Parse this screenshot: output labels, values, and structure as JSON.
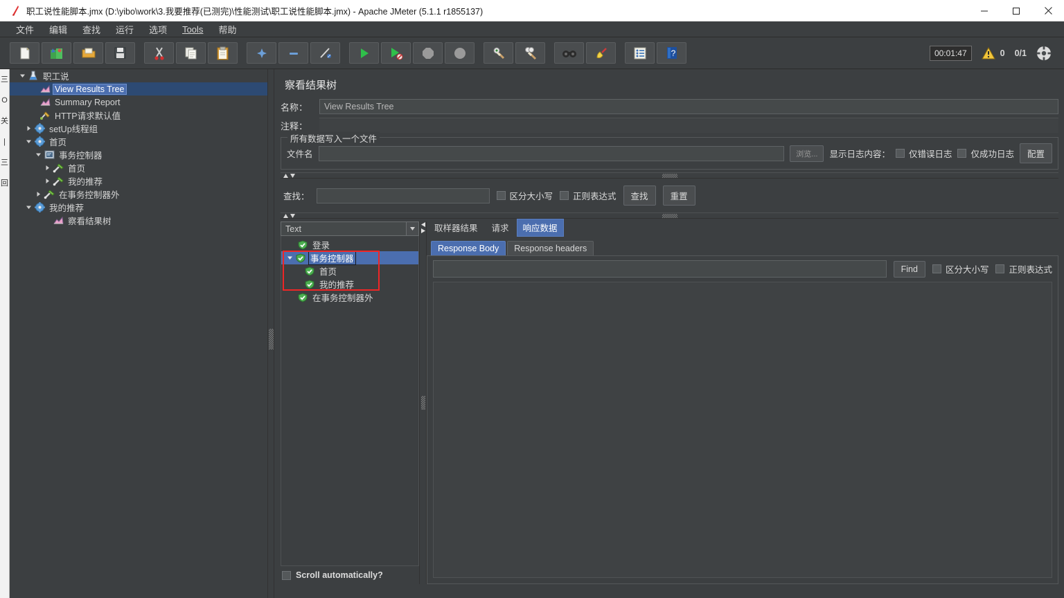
{
  "window": {
    "title": "职工说性能脚本.jmx (D:\\yibo\\work\\3.我要推荐(已测完)\\性能测试\\职工说性能脚本.jmx) - Apache JMeter (5.1.1 r1855137)",
    "app_icon": "jmeter-feather-icon",
    "minimize_label": "—",
    "maximize_label": "☐",
    "close_label": "✕"
  },
  "menubar": {
    "items": [
      {
        "label": "文件",
        "name": "menu-file"
      },
      {
        "label": "编辑",
        "name": "menu-edit"
      },
      {
        "label": "查找",
        "name": "menu-search"
      },
      {
        "label": "运行",
        "name": "menu-run"
      },
      {
        "label": "选项",
        "name": "menu-options"
      },
      {
        "label": "Tools",
        "name": "menu-tools"
      },
      {
        "label": "帮助",
        "name": "menu-help"
      }
    ]
  },
  "toolbar": {
    "buttons": [
      {
        "name": "new-icon",
        "glyph": "📄",
        "tip": "新建"
      },
      {
        "name": "templates-icon",
        "glyph": "🗂",
        "tip": "模板"
      },
      {
        "name": "open-icon",
        "glyph": "📂",
        "tip": "打开"
      },
      {
        "name": "save-icon",
        "glyph": "💾",
        "tip": "保存"
      },
      {
        "name": "cut-icon",
        "glyph": "✂",
        "tip": "剪切"
      },
      {
        "name": "copy-icon",
        "glyph": "📑",
        "tip": "复制"
      },
      {
        "name": "paste-icon",
        "glyph": "📋",
        "tip": "粘贴"
      },
      {
        "name": "expand-all-icon",
        "glyph": "+",
        "tip": "展开全部"
      },
      {
        "name": "collapse-all-icon",
        "glyph": "−",
        "tip": "折叠全部"
      },
      {
        "name": "toggle-icon",
        "glyph": "🖉",
        "tip": "开关"
      },
      {
        "name": "start-icon",
        "glyph": "▶",
        "tip": "启动"
      },
      {
        "name": "start-no-pause-icon",
        "glyph": "▶",
        "tip": "无间隔启动"
      },
      {
        "name": "stop-icon",
        "glyph": "⬤",
        "tip": "停止"
      },
      {
        "name": "shutdown-icon",
        "glyph": "⬤",
        "tip": "关闭"
      },
      {
        "name": "clear-icon",
        "glyph": "🧹",
        "tip": "清除"
      },
      {
        "name": "clear-all-icon",
        "glyph": "🧹",
        "tip": "清除全部"
      },
      {
        "name": "search-icon",
        "glyph": "🔍",
        "tip": "查找"
      },
      {
        "name": "search-reset-icon",
        "glyph": "🔔",
        "tip": "重置查找"
      },
      {
        "name": "function-helper-icon",
        "glyph": "☰",
        "tip": "函数助手"
      },
      {
        "name": "help-icon",
        "glyph": "?",
        "tip": "帮助"
      }
    ],
    "timer": "00:01:47",
    "warning_count": "0",
    "thread_count": "0/1",
    "warning_icon": "warning-triangle-icon",
    "threads-icon": "threads-gear-icon"
  },
  "tree": {
    "nodes": [
      {
        "label": "职工说",
        "depth": 0,
        "toggle": "open",
        "icon": "test-plan-icon",
        "selected": false
      },
      {
        "label": "View Results Tree",
        "depth": 1,
        "toggle": "none",
        "icon": "listener-icon",
        "selected": true
      },
      {
        "label": "Summary Report",
        "depth": 1,
        "toggle": "none",
        "icon": "listener-icon",
        "selected": false
      },
      {
        "label": "HTTP请求默认值",
        "depth": 1,
        "toggle": "none",
        "icon": "config-icon",
        "selected": false
      },
      {
        "label": "setUp线程组",
        "depth": 1,
        "toggle": "closed",
        "icon": "thread-group-icon",
        "selected": false
      },
      {
        "label": "首页",
        "depth": 1,
        "toggle": "open",
        "icon": "thread-group-icon",
        "selected": false
      },
      {
        "label": "事务控制器",
        "depth": 2,
        "toggle": "open",
        "icon": "controller-icon",
        "selected": false
      },
      {
        "label": "首页",
        "depth": 3,
        "toggle": "closed",
        "icon": "http-sampler-icon",
        "selected": false
      },
      {
        "label": "我的推荐",
        "depth": 3,
        "toggle": "closed",
        "icon": "http-sampler-icon",
        "selected": false
      },
      {
        "label": "在事务控制器外",
        "depth": 2,
        "toggle": "closed",
        "icon": "http-sampler-icon",
        "selected": false
      },
      {
        "label": "我的推荐",
        "depth": 1,
        "toggle": "open",
        "icon": "thread-group-icon",
        "selected": false
      },
      {
        "label": "察看结果树",
        "depth": 2,
        "toggle": "none",
        "icon": "listener-icon",
        "selected": false
      }
    ]
  },
  "editor": {
    "title": "察看结果树",
    "name_label": "名称：",
    "name_value": "View Results Tree",
    "comment_label": "注释：",
    "comment_value": "",
    "filegroup": {
      "title": "所有数据写入一个文件",
      "filename_label": "文件名",
      "filename_value": "",
      "browse_label": "浏览...",
      "log_display_label": "显示日志内容：",
      "errors_only_label": "仅错误日志",
      "success_only_label": "仅成功日志",
      "configure_label": "配置",
      "errors_only_checked": false,
      "success_only_checked": false
    },
    "search": {
      "label": "查找：",
      "value": "",
      "case_sensitive_label": "区分大小写",
      "regex_label": "正则表达式",
      "find_button": "查找",
      "reset_button": "重置",
      "case_sensitive_checked": false,
      "regex_checked": false
    },
    "render_combo": {
      "value": "Text",
      "arrow": "chevron-down-icon"
    },
    "results": [
      {
        "label": "登录",
        "depth": 0,
        "toggle": "none",
        "status": "success",
        "selected": false
      },
      {
        "label": "事务控制器",
        "depth": 0,
        "toggle": "open",
        "status": "success",
        "selected": true
      },
      {
        "label": "首页",
        "depth": 1,
        "toggle": "none",
        "status": "success",
        "selected": false
      },
      {
        "label": "我的推荐",
        "depth": 1,
        "toggle": "none",
        "status": "success",
        "selected": false
      },
      {
        "label": "在事务控制器外",
        "depth": 0,
        "toggle": "none",
        "status": "success",
        "selected": false
      }
    ],
    "annotation": {
      "color": "#ef2626",
      "around": "事务控制器"
    },
    "scroll_auto_label": "Scroll automatically?",
    "scroll_auto_checked": false,
    "tabs": [
      {
        "label": "取样器结果",
        "active": false
      },
      {
        "label": "请求",
        "active": false
      },
      {
        "label": "响应数据",
        "active": true
      }
    ],
    "subtabs": [
      {
        "label": "Response Body",
        "active": true
      },
      {
        "label": "Response headers",
        "active": false
      }
    ],
    "find": {
      "value": "",
      "button": "Find",
      "case_sensitive_label": "区分大小写",
      "regex_label": "正则表达式",
      "case_sensitive_checked": false,
      "regex_checked": false
    },
    "response_body": ""
  },
  "background_window": {
    "lines": [
      "三",
      "O",
      "关",
      "|",
      "三",
      "",
      "回"
    ]
  },
  "colors": {
    "panel": "#3c3f41",
    "selection": "#4b6eaf",
    "annotation": "#ef2626",
    "text": "#d4d4d4"
  }
}
